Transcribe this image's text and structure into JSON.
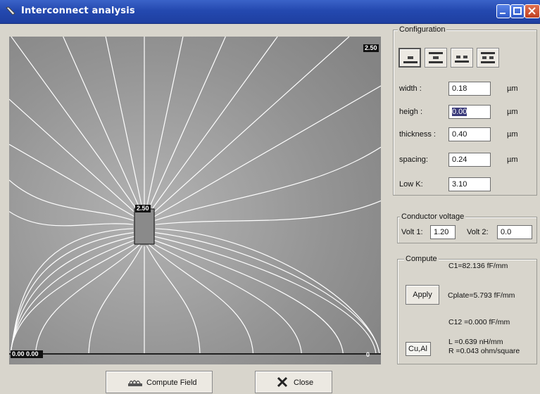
{
  "window": {
    "title": "Interconnect analysis",
    "title_icon": "app-icon",
    "controls": [
      "minimize-icon",
      "maximize-icon",
      "close-icon"
    ]
  },
  "plot": {
    "label_top_right": "2.50",
    "label_conductor": "2.50",
    "label_bottom_left": "0.00 0.00",
    "label_bottom_right": "0"
  },
  "configuration": {
    "legend": "Configuration",
    "toolbar": [
      "single-line-icon",
      "embedded-line-icon",
      "coplanar-lines-icon",
      "stacked-lines-icon"
    ],
    "fields": [
      {
        "label": "width :",
        "value": "0.18",
        "unit": "µm"
      },
      {
        "label": "heigh :",
        "value": "0.00",
        "unit": "µm"
      },
      {
        "label": "thickness :",
        "value": "0.40",
        "unit": "µm"
      },
      {
        "label": "spacing:",
        "value": "0.24",
        "unit": "µm"
      },
      {
        "label": "Low K:",
        "value": "3.10",
        "unit": ""
      }
    ]
  },
  "voltage": {
    "legend": "Conductor voltage",
    "volt1_label": "Volt 1:",
    "volt1_value": "1.20",
    "volt2_label": "Volt 2:",
    "volt2_value": "0.0"
  },
  "compute": {
    "legend": "Compute",
    "apply_label": "Apply",
    "material": "Cu,Al",
    "results": [
      "C1=82.136 fF/mm",
      "Cplate=5.793 fF/mm",
      "C12 =0.000 fF/mm",
      "L =0.639 nH/mm",
      "R =0.043 ohm/square"
    ]
  },
  "buttons": {
    "compute_field": "Compute Field",
    "close": "Close"
  },
  "colors": {
    "titlebar": "#2449b0",
    "plot_bg": "#8a8a8a",
    "field_lines": "#ffffff",
    "conductor": "#8a8a8a",
    "dialog_bg": "#d8d5cc"
  }
}
